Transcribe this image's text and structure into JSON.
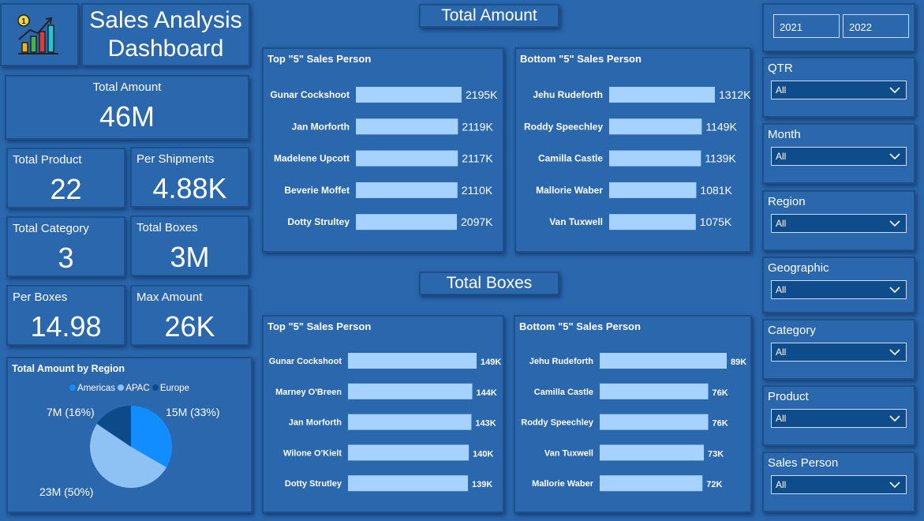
{
  "header": {
    "title_line1": "Sales Analysis",
    "title_line2": "Dashboard",
    "logo_icon": "chart-growth-icon"
  },
  "kpis": {
    "total_amount": {
      "label": "Total Amount",
      "value": "46M"
    },
    "total_product": {
      "label": "Total Product",
      "value": "22"
    },
    "per_shipments": {
      "label": "Per Shipments",
      "value": "4.88K"
    },
    "total_category": {
      "label": "Total Category",
      "value": "3"
    },
    "total_boxes": {
      "label": "Total Boxes",
      "value": "3M"
    },
    "per_boxes": {
      "label": "Per Boxes",
      "value": "14.98"
    },
    "max_amount": {
      "label": "Max Amount",
      "value": "26K"
    }
  },
  "sections": {
    "amount_title": "Total Amount",
    "boxes_title": "Total Boxes"
  },
  "colors": {
    "bar": "#a6d2ff",
    "americas": "#118dff",
    "apac": "#8fc2f4",
    "europe": "#0c4a8a",
    "background": "#2a67ad"
  },
  "chart_data": [
    {
      "type": "bar",
      "title": "Top \"5\" Sales Person",
      "categories": [
        "Gunar Cockshoot",
        "Jan Morforth",
        "Madelene Upcott",
        "Beverie Moffet",
        "Dotty Strultey"
      ],
      "values": [
        2195,
        2119,
        2117,
        2110,
        2097
      ],
      "labels": [
        "2195K",
        "2119K",
        "2117K",
        "2110K",
        "2097K"
      ],
      "unit": "K"
    },
    {
      "type": "bar",
      "title": "Bottom \"5\" Sales Person",
      "categories": [
        "Jehu Rudeforth",
        "Roddy Speechley",
        "Camilla Castle",
        "Mallorie Waber",
        "Van Tuxwell"
      ],
      "values": [
        1312,
        1149,
        1139,
        1081,
        1075
      ],
      "labels": [
        "1312K",
        "1149K",
        "1139K",
        "1081K",
        "1075K"
      ],
      "unit": "K"
    },
    {
      "type": "bar",
      "title": "Top \"5\" Sales Person",
      "categories": [
        "Gunar Cockshoot",
        "Marney O'Breen",
        "Jan Morforth",
        "Wilone O'Kielt",
        "Dotty Strutley"
      ],
      "values": [
        149,
        144,
        143,
        140,
        139
      ],
      "labels": [
        "149K",
        "144K",
        "143K",
        "140K",
        "139K"
      ],
      "unit": "K"
    },
    {
      "type": "bar",
      "title": "Bottom \"5\" Sales Person",
      "categories": [
        "Jehu Rudeforth",
        "Camilla Castle",
        "Roddy Speechley",
        "Van Tuxwell",
        "Mallorie Waber"
      ],
      "values": [
        89,
        76,
        76,
        73,
        72
      ],
      "labels": [
        "89K",
        "76K",
        "76K",
        "73K",
        "72K"
      ],
      "unit": "K"
    },
    {
      "type": "pie",
      "title": "Total Amount by Region",
      "categories": [
        "Americas",
        "APAC",
        "Europe"
      ],
      "values": [
        15,
        23,
        7
      ],
      "labels": [
        "15M (33%)",
        "23M (50%)",
        "7M (16%)"
      ],
      "legend": "top"
    }
  ],
  "years": [
    "2021",
    "2022"
  ],
  "slicers": [
    {
      "label": "QTR",
      "value": "All"
    },
    {
      "label": "Month",
      "value": "All"
    },
    {
      "label": "Region",
      "value": "All"
    },
    {
      "label": "Geographic",
      "value": "All"
    },
    {
      "label": "Category",
      "value": "All"
    },
    {
      "label": "Product",
      "value": "All"
    },
    {
      "label": "Sales Person",
      "value": "All"
    }
  ],
  "icons": {
    "dropdown": "chevron-down-icon"
  }
}
